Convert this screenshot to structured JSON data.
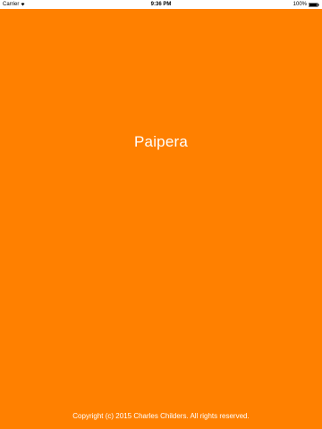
{
  "status_bar": {
    "carrier": "Carrier",
    "time": "9:36 PM",
    "battery_percent": "100%",
    "icons": [
      "wifi-icon",
      "battery-icon"
    ]
  },
  "splash": {
    "app_title": "Paipera",
    "copyright": "Copyright (c) 2015 Charles Childers. All rights reserved."
  },
  "colors": {
    "background": "#FF8000",
    "text": "#FFFFFF",
    "status_bar_bg": "#FFFFFF"
  }
}
